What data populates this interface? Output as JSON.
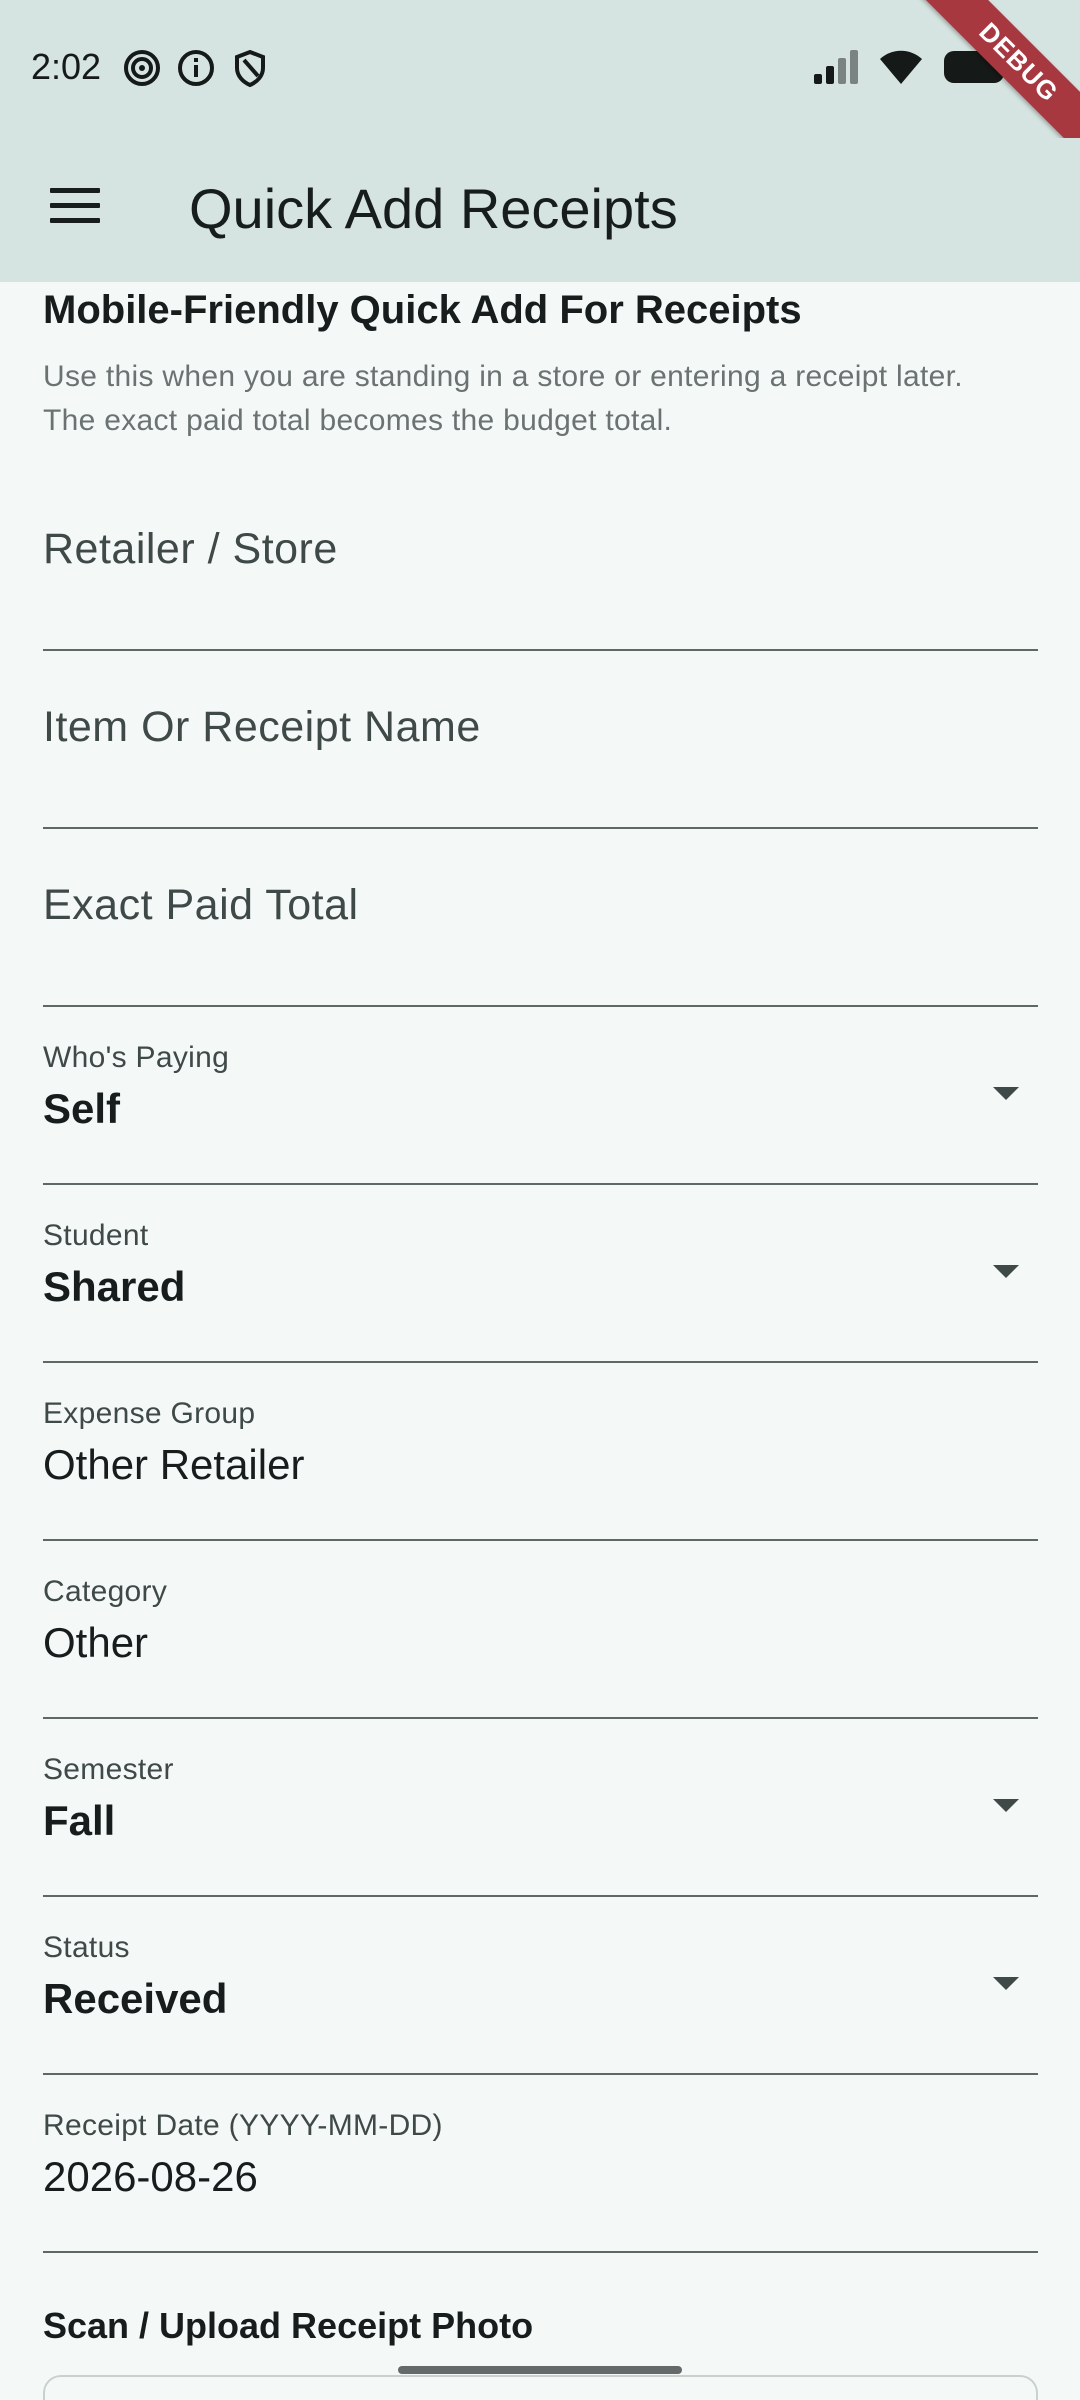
{
  "status_bar": {
    "time": "2:02",
    "debug_label": "DEBUG"
  },
  "app_bar": {
    "title": "Quick Add Receipts"
  },
  "section": {
    "title": "Mobile-Friendly Quick Add For Receipts",
    "description_line1": "Use this when you are standing in a store or entering a receipt later.",
    "description_line2": "The exact paid total becomes the budget total."
  },
  "fields": {
    "retailer": {
      "placeholder": "Retailer / Store"
    },
    "item_name": {
      "placeholder": "Item Or Receipt Name"
    },
    "paid_total": {
      "placeholder": "Exact Paid Total"
    },
    "who_paying": {
      "label": "Who's Paying",
      "value": "Self"
    },
    "student": {
      "label": "Student",
      "value": "Shared"
    },
    "expense_group": {
      "label": "Expense Group",
      "value": "Other Retailer"
    },
    "category": {
      "label": "Category",
      "value": "Other"
    },
    "semester": {
      "label": "Semester",
      "value": "Fall"
    },
    "status": {
      "label": "Status",
      "value": "Received"
    },
    "receipt_date": {
      "label": "Receipt Date (YYYY-MM-DD)",
      "value": "2026-08-26"
    }
  },
  "scan": {
    "title": "Scan / Upload Receipt Photo"
  },
  "icons": {
    "status_left": [
      "spiral-icon",
      "info-icon",
      "shield-icon"
    ],
    "status_right": [
      "signal-icon",
      "wifi-icon",
      "battery-icon"
    ],
    "menu": "hamburger-menu-icon",
    "dropdown": "caret-down-icon"
  },
  "colors": {
    "app_bar_bg": "#d6e4e1",
    "page_bg": "#f4f9f8",
    "debug_ribbon": "#a8383f"
  }
}
